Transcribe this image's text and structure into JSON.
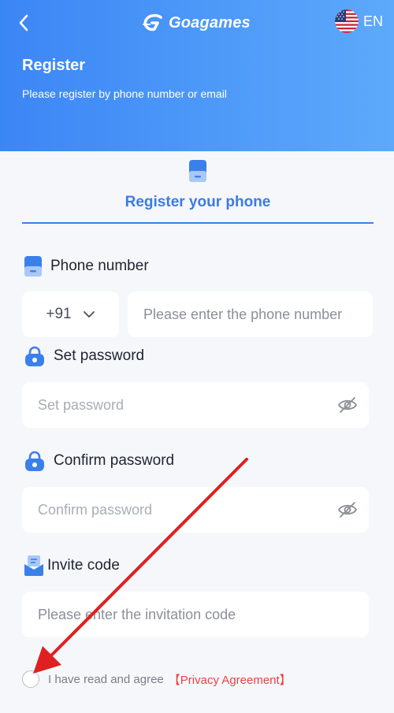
{
  "header": {
    "brand": "Goagames",
    "language": "EN",
    "title": "Register",
    "subtitle": "Please register by phone number or email"
  },
  "tab": {
    "label": "Register your phone"
  },
  "phone": {
    "label": "Phone number",
    "country_code": "+91",
    "placeholder": "Please enter the phone number"
  },
  "password": {
    "label": "Set password",
    "placeholder": "Set password"
  },
  "confirm": {
    "label": "Confirm password",
    "placeholder": "Confirm password"
  },
  "invite": {
    "label": "Invite code",
    "placeholder": "Please enter the invitation code"
  },
  "agreement": {
    "text": "I have read and agree",
    "link": "【Privacy Agreement】"
  },
  "colors": {
    "header_gradient_start": "#3b86f5",
    "header_gradient_end": "#5da9fb",
    "accent": "#3a7be8",
    "link": "#e94242",
    "annotation_arrow": "#e02020"
  }
}
